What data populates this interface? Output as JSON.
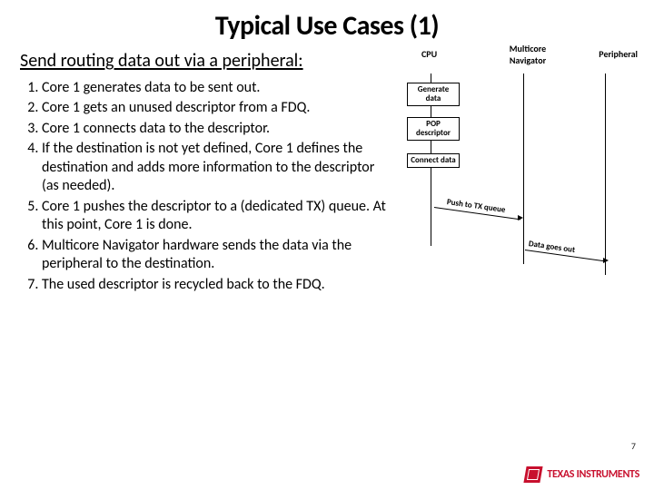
{
  "title": "Typical Use Cases (1)",
  "subtitle": "Send routing data out via a peripheral:",
  "steps": [
    "Core 1 generates data to be sent out.",
    "Core 1 gets an unused descriptor from a FDQ.",
    "Core 1 connects data to the descriptor.",
    "If the destination is not yet defined, Core 1 defines the destination and adds more information to the descriptor (as needed).",
    "Core 1 pushes the descriptor to a (dedicated TX) queue. At this point, Core 1 is done.",
    "Multicore Navigator hardware sends the data via the peripheral to the destination.",
    "The used descriptor is recycled back to the FDQ."
  ],
  "diagram": {
    "columns": {
      "cpu": "CPU",
      "nav": "Multicore\nNavigator",
      "per": "Peripheral"
    },
    "boxes": {
      "generate": "Generate\ndata",
      "pop": "POP\ndescriptor",
      "connect": "Connect data"
    },
    "messages": {
      "push": "Push to TX queue",
      "out": "Data goes out"
    }
  },
  "page_number": "7",
  "logo_text": "TEXAS INSTRUMENTS"
}
